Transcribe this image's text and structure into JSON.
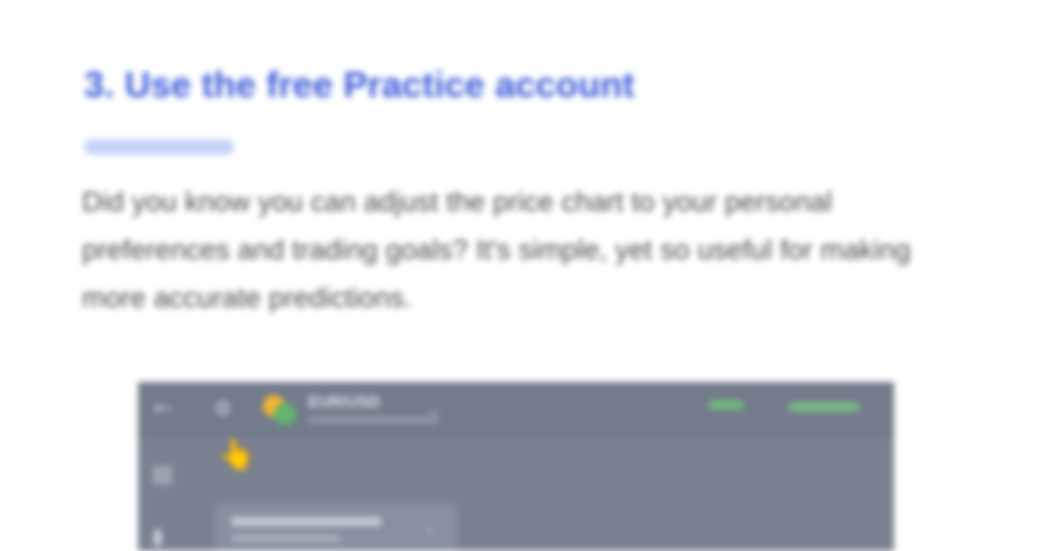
{
  "article": {
    "title": "3. Use the free Practice account",
    "body": "Did you know you can adjust the price chart to your personal preferences and trading goals? It's simple, yet so useful for making more accurate predictions."
  },
  "screenshot": {
    "asset_name": "EUR/USD",
    "icons": {
      "back": "back-arrow-icon",
      "settings": "settings-icon",
      "asset": "currency-pair-icon",
      "chevron": "chevron-down-icon",
      "pointer": "pointing-hand-icon",
      "sidebar_a": "chart-icon",
      "sidebar_b": "bookmark-icon"
    },
    "colors": {
      "panel_bg": "#7a8191",
      "accent_green": "#6fb87a"
    }
  },
  "colors": {
    "title": "#3a5bd9",
    "underline": "#c7d3f6",
    "body_text": "#4a4a4a"
  }
}
